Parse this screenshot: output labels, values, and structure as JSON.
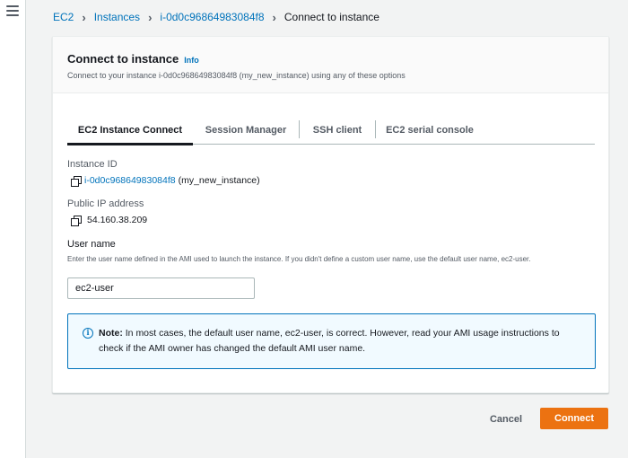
{
  "breadcrumb": {
    "items": [
      "EC2",
      "Instances",
      "i-0d0c96864983084f8"
    ],
    "current": "Connect to instance"
  },
  "panel": {
    "title": "Connect to instance",
    "info_label": "Info",
    "description": "Connect to your instance i-0d0c96864983084f8 (my_new_instance) using any of these options"
  },
  "tabs": [
    {
      "label": "EC2 Instance Connect",
      "active": true
    },
    {
      "label": "Session Manager",
      "active": false
    },
    {
      "label": "SSH client",
      "active": false
    },
    {
      "label": "EC2 serial console",
      "active": false
    }
  ],
  "instance": {
    "id_label": "Instance ID",
    "id": "i-0d0c96864983084f8",
    "name": "(my_new_instance)",
    "ip_label": "Public IP address",
    "ip": "54.160.38.209"
  },
  "username": {
    "label": "User name",
    "helper": "Enter the user name defined in the AMI used to launch the instance. If you didn't define a custom user name, use the default user name, ec2-user.",
    "value": "ec2-user"
  },
  "alert": {
    "note_label": "Note:",
    "text": "In most cases, the default user name, ec2-user, is correct. However, read your AMI usage instructions to check if the AMI owner has changed the default AMI user name."
  },
  "actions": {
    "cancel": "Cancel",
    "connect": "Connect"
  },
  "colors": {
    "link": "#0073bb",
    "primary_button": "#ec7211",
    "alert_bg": "#f1faff"
  },
  "icons": {
    "menu": "hamburger-icon",
    "copy": "copy-icon",
    "info": "info-icon",
    "separator": "chevron-right-icon"
  }
}
